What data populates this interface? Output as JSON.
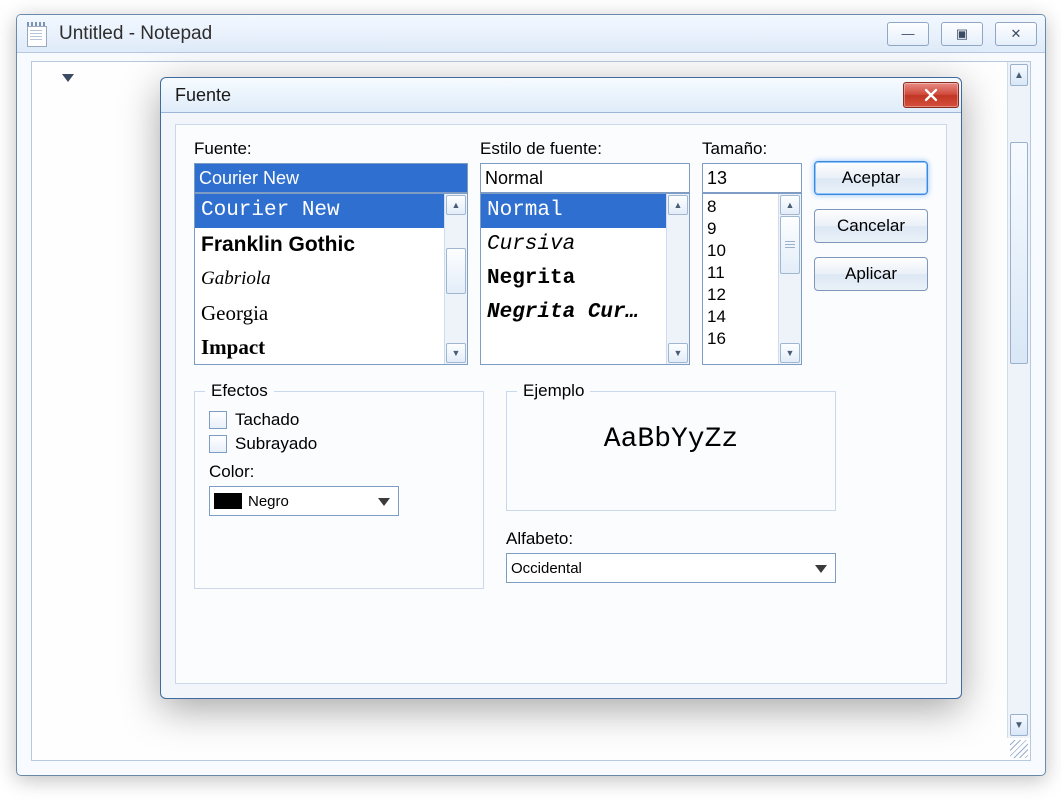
{
  "main_window": {
    "title": "Untitled - Notepad",
    "min_glyph": "―",
    "max_glyph": "▣",
    "close_glyph": "✕"
  },
  "dialog": {
    "title": "Fuente",
    "labels": {
      "font": "Fuente:",
      "style": "Estilo de fuente:",
      "size": "Tamaño:",
      "effects": "Efectos",
      "sample": "Ejemplo",
      "strike": "Tachado",
      "underline": "Subrayado",
      "color": "Color:",
      "script": "Alfabeto:"
    },
    "font": {
      "value": "Courier New",
      "items": [
        "Courier New",
        "Franklin Gothic",
        "Gabriola",
        "Georgia",
        "Impact"
      ]
    },
    "style": {
      "value": "Normal",
      "items": [
        "Normal",
        "Cursiva",
        "Negrita",
        "Negrita Cur…"
      ]
    },
    "size": {
      "value": "13",
      "items": [
        "8",
        "9",
        "10",
        "11",
        "12",
        "14",
        "16"
      ]
    },
    "color_value": "Negro",
    "script_value": "Occidental",
    "sample_text": "AaBbYyZz",
    "buttons": {
      "ok": "Aceptar",
      "cancel": "Cancelar",
      "apply": "Aplicar"
    }
  }
}
